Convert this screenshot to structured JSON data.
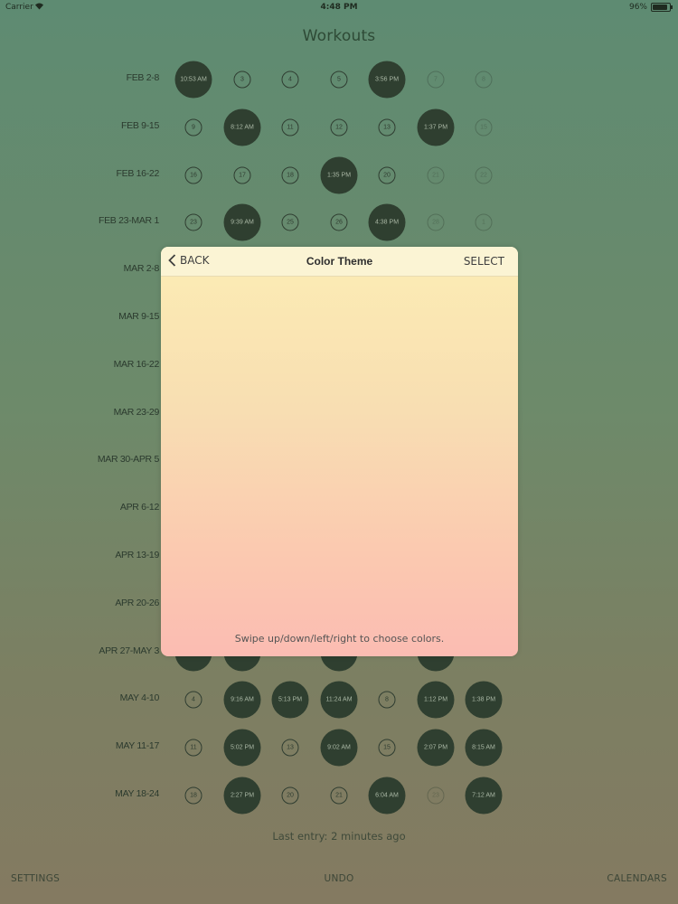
{
  "status": {
    "carrier": "Carrier",
    "time": "4:48 PM",
    "battery": "96%"
  },
  "title": "Workouts",
  "days_x": [
    214,
    268,
    321,
    375,
    428,
    482,
    535
  ],
  "weeks": [
    {
      "label": "FEB 2-8",
      "days": [
        {
          "kind": "big",
          "text": "10:53 AM"
        },
        {
          "kind": "small",
          "text": "3"
        },
        {
          "kind": "small",
          "text": "4"
        },
        {
          "kind": "small",
          "text": "5"
        },
        {
          "kind": "big",
          "text": "3:56 PM"
        },
        {
          "kind": "small faded",
          "text": "7"
        },
        {
          "kind": "small faded",
          "text": "8"
        }
      ]
    },
    {
      "label": "FEB 9-15",
      "days": [
        {
          "kind": "small",
          "text": "9"
        },
        {
          "kind": "big",
          "text": "8:12 AM"
        },
        {
          "kind": "small",
          "text": "11"
        },
        {
          "kind": "small",
          "text": "12"
        },
        {
          "kind": "small",
          "text": "13"
        },
        {
          "kind": "big",
          "text": "1:37 PM"
        },
        {
          "kind": "small faded",
          "text": "15"
        }
      ]
    },
    {
      "label": "FEB 16-22",
      "days": [
        {
          "kind": "small",
          "text": "16"
        },
        {
          "kind": "small",
          "text": "17"
        },
        {
          "kind": "small",
          "text": "18"
        },
        {
          "kind": "big",
          "text": "1:35 PM"
        },
        {
          "kind": "small",
          "text": "20"
        },
        {
          "kind": "small faded",
          "text": "21"
        },
        {
          "kind": "small faded",
          "text": "22"
        }
      ]
    },
    {
      "label": "FEB 23-MAR 1",
      "days": [
        {
          "kind": "small",
          "text": "23"
        },
        {
          "kind": "big",
          "text": "9:39 AM"
        },
        {
          "kind": "small",
          "text": "25"
        },
        {
          "kind": "small",
          "text": "26"
        },
        {
          "kind": "big",
          "text": "4:38 PM"
        },
        {
          "kind": "small faded",
          "text": "28"
        },
        {
          "kind": "small faded",
          "text": "1"
        }
      ]
    },
    {
      "label": "MAR 2-8",
      "days": []
    },
    {
      "label": "MAR 9-15",
      "days": []
    },
    {
      "label": "MAR 16-22",
      "days": []
    },
    {
      "label": "MAR 23-29",
      "days": []
    },
    {
      "label": "MAR 30-APR 5",
      "days": []
    },
    {
      "label": "APR 6-12",
      "days": []
    },
    {
      "label": "APR 13-19",
      "days": []
    },
    {
      "label": "APR 20-26",
      "days": []
    },
    {
      "label": "APR 27-MAY 3",
      "days": [
        {
          "kind": "big",
          "text": ""
        },
        {
          "kind": "big",
          "text": ""
        },
        {
          "kind": "empty",
          "text": ""
        },
        {
          "kind": "big",
          "text": ""
        },
        {
          "kind": "empty",
          "text": ""
        },
        {
          "kind": "big",
          "text": ""
        },
        {
          "kind": "empty",
          "text": ""
        }
      ]
    },
    {
      "label": "MAY 4-10",
      "days": [
        {
          "kind": "small",
          "text": "4"
        },
        {
          "kind": "big",
          "text": "9:16 AM"
        },
        {
          "kind": "big",
          "text": "5:13 PM"
        },
        {
          "kind": "big",
          "text": "11:24 AM"
        },
        {
          "kind": "small",
          "text": "8"
        },
        {
          "kind": "big",
          "text": "1:12 PM"
        },
        {
          "kind": "big",
          "text": "1:38 PM"
        }
      ]
    },
    {
      "label": "MAY 11-17",
      "days": [
        {
          "kind": "small",
          "text": "11"
        },
        {
          "kind": "big",
          "text": "5:02 PM"
        },
        {
          "kind": "small",
          "text": "13"
        },
        {
          "kind": "big",
          "text": "9:02 AM"
        },
        {
          "kind": "small",
          "text": "15"
        },
        {
          "kind": "big",
          "text": "2:07 PM"
        },
        {
          "kind": "big",
          "text": "8:15 AM"
        }
      ]
    },
    {
      "label": "MAY 18-24",
      "days": [
        {
          "kind": "small",
          "text": "18"
        },
        {
          "kind": "big",
          "text": "2:27 PM"
        },
        {
          "kind": "small",
          "text": "20"
        },
        {
          "kind": "small",
          "text": "21"
        },
        {
          "kind": "big",
          "text": "6:04 AM"
        },
        {
          "kind": "small faded",
          "text": "23"
        },
        {
          "kind": "big",
          "text": "7:12 AM"
        }
      ]
    }
  ],
  "last_entry": "Last entry: 2 minutes ago",
  "bottom": {
    "settings": "SETTINGS",
    "undo": "UNDO",
    "calendars": "CALENDARS"
  },
  "modal": {
    "back": "BACK",
    "title": "Color Theme",
    "select": "SELECT",
    "hint": "Swipe up/down/left/right to choose colors."
  }
}
